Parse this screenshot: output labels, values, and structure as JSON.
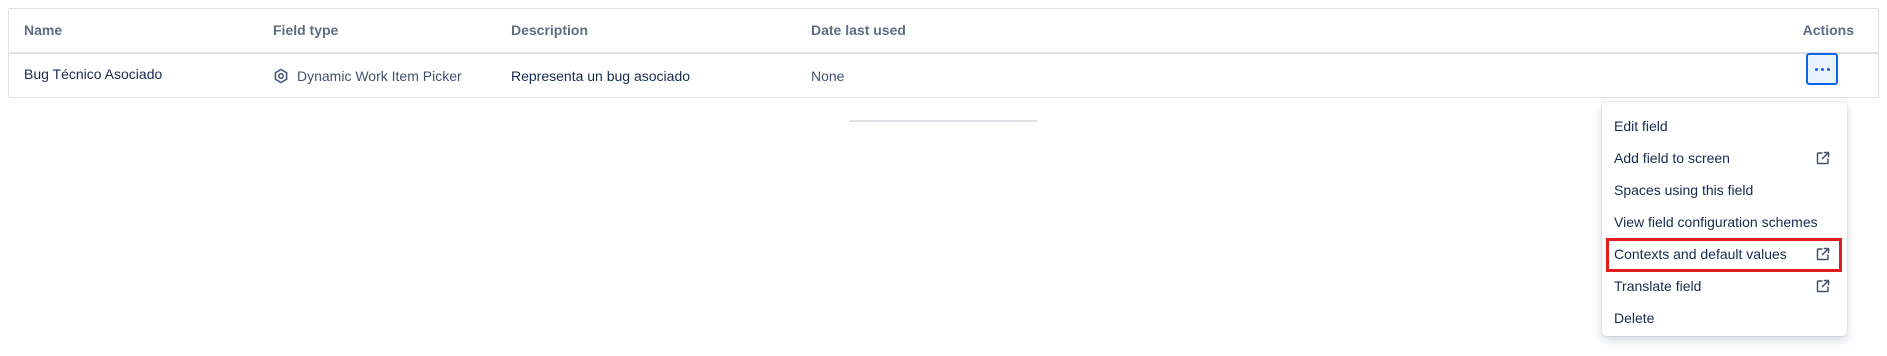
{
  "table": {
    "columns": {
      "name": "Name",
      "field_type": "Field type",
      "description": "Description",
      "date_last_used": "Date last used",
      "actions": "Actions"
    },
    "rows": [
      {
        "name": "Bug Técnico Asociado",
        "field_type": "Dynamic Work Item Picker",
        "field_type_icon": "hexagon-icon",
        "description": "Representa un bug asociado",
        "date_last_used": "None"
      }
    ]
  },
  "actions_menu": {
    "trigger_icon": "more-horizontal-icon",
    "items": [
      {
        "label": "Edit field",
        "external": false
      },
      {
        "label": "Add field to screen",
        "external": true
      },
      {
        "label": "Spaces using this field",
        "external": false
      },
      {
        "label": "View field configuration schemes",
        "external": false
      },
      {
        "label": "Contexts and default values",
        "external": true,
        "highlighted": true
      },
      {
        "label": "Translate field",
        "external": true
      },
      {
        "label": "Delete",
        "external": false
      }
    ]
  },
  "colors": {
    "accent": "#0c66e4",
    "highlight_border": "#e31b1b",
    "header_text": "#5e6c84"
  }
}
